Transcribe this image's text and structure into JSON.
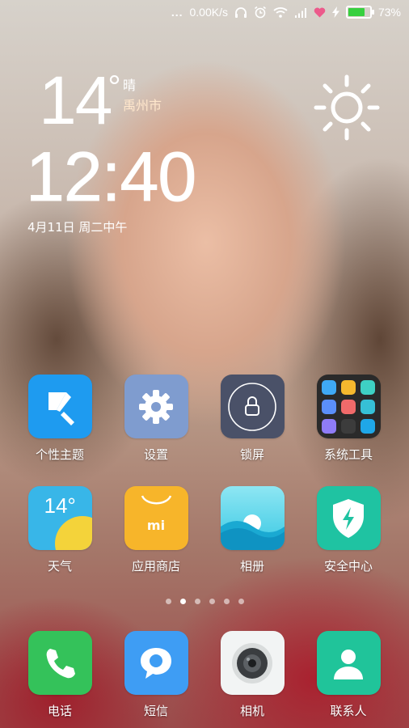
{
  "status_bar": {
    "network_speed": "0.00K/s",
    "battery_percent": "73%",
    "battery_level": 0.73,
    "more_dots": "...",
    "icons": [
      "headphones-icon",
      "alarm-icon",
      "wifi-icon",
      "signal-icon",
      "heart-icon",
      "charging-icon",
      "battery-icon"
    ]
  },
  "weather": {
    "temperature": "14",
    "degree_symbol": "°",
    "condition": "晴",
    "city": "禹州市",
    "icon": "sun-icon"
  },
  "clock": {
    "time": "12:40",
    "date": "4月11日 周二中午"
  },
  "pager": {
    "pages": 6,
    "current": 2
  },
  "apps_row1": [
    {
      "label": "个性主题",
      "icon": "theme-brush-icon",
      "color": "#1e9bf0"
    },
    {
      "label": "设置",
      "icon": "gear-icon",
      "color": "#7f9ccf"
    },
    {
      "label": "锁屏",
      "icon": "lock-icon",
      "color": "#4a5168"
    },
    {
      "label": "系统工具",
      "icon": "folder-icon",
      "color": "#2a2a2a"
    }
  ],
  "apps_row2": [
    {
      "label": "天气",
      "icon": "weather-icon",
      "icon_text": "14°",
      "color": "#38b6e8"
    },
    {
      "label": "应用商店",
      "icon": "shopping-bag-icon",
      "icon_text": "mi",
      "color": "#f7b52a"
    },
    {
      "label": "相册",
      "icon": "gallery-icon",
      "color": "#3ec8e0"
    },
    {
      "label": "安全中心",
      "icon": "security-shield-icon",
      "color": "#1fc3a2"
    }
  ],
  "dock": [
    {
      "label": "电话",
      "icon": "phone-icon",
      "color": "#34c25a"
    },
    {
      "label": "短信",
      "icon": "message-icon",
      "color": "#3e9df4"
    },
    {
      "label": "相机",
      "icon": "camera-icon",
      "color": "#f2f4f4"
    },
    {
      "label": "联系人",
      "icon": "contacts-icon",
      "color": "#20c49a"
    }
  ]
}
